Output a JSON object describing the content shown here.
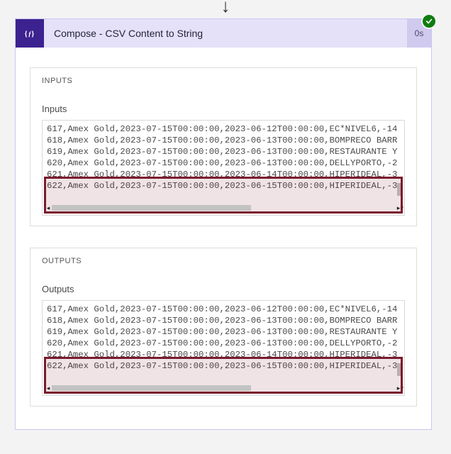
{
  "action": {
    "title": "Compose - CSV Content to String",
    "duration": "0s",
    "status": "success"
  },
  "panels": {
    "inputs": {
      "heading": "INPUTS",
      "sublabel": "Inputs",
      "content": "617,Amex Gold,2023-07-15T00:00:00,2023-06-12T00:00:00,EC*NIVEL6,-14\n618,Amex Gold,2023-07-15T00:00:00,2023-06-13T00:00:00,BOMPRECO BARR\n619,Amex Gold,2023-07-15T00:00:00,2023-06-13T00:00:00,RESTAURANTE Y\n620,Amex Gold,2023-07-15T00:00:00,2023-06-13T00:00:00,DELLYPORTO,-2\n621,Amex Gold,2023-07-15T00:00:00,2023-06-14T00:00:00,HIPERIDEAL,-3\n622,Amex Gold,2023-07-15T00:00:00,2023-06-15T00:00:00,HIPERIDEAL,-3"
    },
    "outputs": {
      "heading": "OUTPUTS",
      "sublabel": "Outputs",
      "content": "617,Amex Gold,2023-07-15T00:00:00,2023-06-12T00:00:00,EC*NIVEL6,-14\n618,Amex Gold,2023-07-15T00:00:00,2023-06-13T00:00:00,BOMPRECO BARR\n619,Amex Gold,2023-07-15T00:00:00,2023-06-13T00:00:00,RESTAURANTE Y\n620,Amex Gold,2023-07-15T00:00:00,2023-06-13T00:00:00,DELLYPORTO,-2\n621,Amex Gold,2023-07-15T00:00:00,2023-06-14T00:00:00,HIPERIDEAL,-3\n622,Amex Gold,2023-07-15T00:00:00,2023-06-15T00:00:00,HIPERIDEAL,-3"
    }
  },
  "colors": {
    "header_bg": "#e5e1f8",
    "header_icon_bg": "#3c228f",
    "duration_bg": "#d0caee",
    "success_green": "#107c10",
    "highlight_border": "#7a1b2c"
  }
}
